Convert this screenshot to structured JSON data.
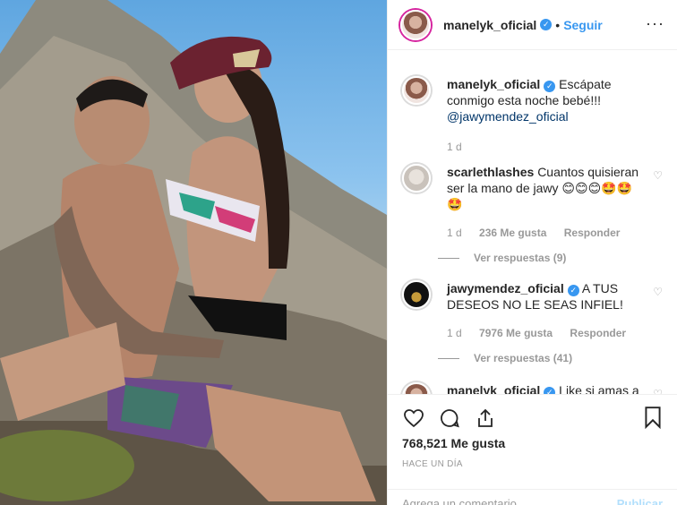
{
  "header": {
    "username": "manelyk_oficial",
    "separator": "•",
    "follow_label": "Seguir",
    "more": "···"
  },
  "caption": {
    "username": "manelyk_oficial",
    "text": "Escápate conmigo esta noche bebé!!!",
    "mention": "@jawymendez_oficial",
    "time": "1 d"
  },
  "comments": [
    {
      "username": "scarlethlashes",
      "text": "Cuantos quisieran ser la mano de jawy 😊😊😊🤩🤩🤩",
      "time": "1 d",
      "likes": "236 Me gusta",
      "reply": "Responder",
      "replies": "Ver respuestas (9)"
    },
    {
      "username": "jawymendez_oficial",
      "text": "A TUS DESEOS NO LE SEAS INFIEL!",
      "time": "1 d",
      "likes": "7976 Me gusta",
      "reply": "Responder",
      "replies": "Ver respuestas (41)"
    },
    {
      "username": "manelyk_oficial",
      "text": "Like si amas a"
    }
  ],
  "footer": {
    "likes": "768,521 Me gusta",
    "ago": "HACE UN DÍA",
    "comment_placeholder": "Agrega un comentario...",
    "publish": "Publicar"
  },
  "icons": [
    "heart-icon",
    "comment-icon",
    "share-icon",
    "bookmark-icon",
    "verified-icon",
    "more-icon"
  ]
}
